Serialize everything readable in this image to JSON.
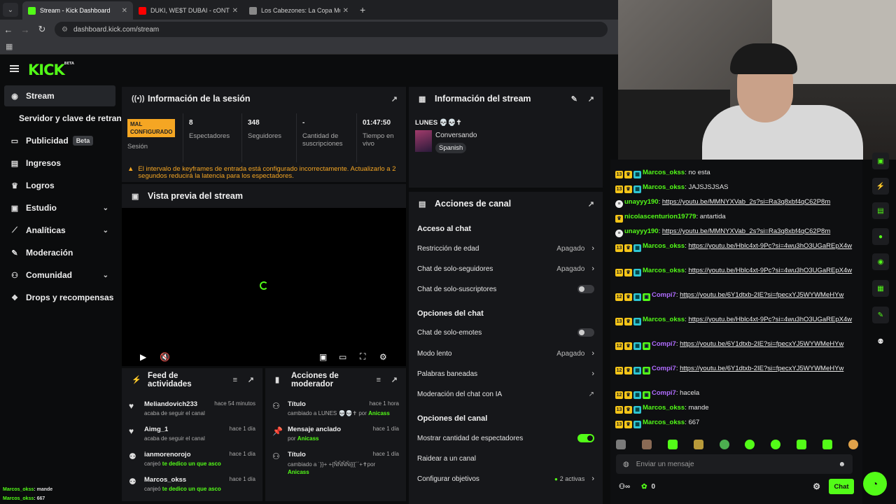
{
  "browser": {
    "tabs": [
      {
        "title": "Stream - Kick Dashboard",
        "color": "#53fc18"
      },
      {
        "title": "DUKI, WE$T DUBAI - cONTRA M",
        "color": "#ff0000"
      },
      {
        "title": "Los Cabezones: La Copa Mundi",
        "color": "#888888"
      }
    ],
    "url": "dashboard.kick.com/stream"
  },
  "header": {
    "logo": "KICK",
    "logo_tag": "BETA"
  },
  "sidebar": {
    "items": [
      {
        "label": "Stream",
        "icon": "broadcast-icon"
      },
      {
        "label": "Servidor y clave de retransmi"
      },
      {
        "label": "Publicidad",
        "badge": "Beta",
        "icon": "ads-icon"
      },
      {
        "label": "Ingresos",
        "icon": "revenue-icon"
      },
      {
        "label": "Logros",
        "icon": "trophy-icon"
      },
      {
        "label": "Estudio",
        "icon": "studio-icon"
      },
      {
        "label": "Analíticas",
        "icon": "chart-icon"
      },
      {
        "label": "Moderación",
        "icon": "wrench-icon"
      },
      {
        "label": "Comunidad",
        "icon": "community-icon"
      },
      {
        "label": "Drops y recompensas",
        "icon": "gift-icon"
      }
    ],
    "overlay_lines": [
      {
        "user": "Marcos_okss",
        "msg": ": mande"
      },
      {
        "user": "Marcos_okss",
        "msg": ": 667"
      }
    ]
  },
  "session": {
    "title": "Información de la sesión",
    "status_badge": "MAL CONFIGURADO",
    "status_label": "Sesión",
    "stats": [
      {
        "value": "8",
        "label": "Espectadores"
      },
      {
        "value": "348",
        "label": "Seguidores"
      },
      {
        "value": "-",
        "label": "Cantidad de suscripciones"
      },
      {
        "value": "01:47:50",
        "label": "Tiempo en vivo"
      }
    ],
    "warning": "El intervalo de keyframes de entrada está configurado incorrectamente. Actualizarlo a 2 segundos reducirá la latencia para los espectadores."
  },
  "preview": {
    "title": "Vista previa del stream"
  },
  "stream_info": {
    "title": "Información del stream",
    "stream_title": "LUNES 💀💀✝",
    "category": "Conversando",
    "language": "Spanish"
  },
  "channel_actions": {
    "title": "Acciones de canal",
    "sections": {
      "chat_access": "Acceso al chat",
      "chat_options": "Opciones del chat",
      "channel_options": "Opciones del canal"
    },
    "rows": {
      "age": {
        "label": "Restricción de edad",
        "value": "Apagado"
      },
      "followers": {
        "label": "Chat de solo-seguidores",
        "value": "Apagado"
      },
      "subs": {
        "label": "Chat de solo-suscriptores"
      },
      "emotes": {
        "label": "Chat de solo-emotes"
      },
      "slow": {
        "label": "Modo lento",
        "value": "Apagado"
      },
      "banned": {
        "label": "Palabras baneadas"
      },
      "ai_mod": {
        "label": "Moderación del chat con IA"
      },
      "viewer_count": {
        "label": "Mostrar cantidad de espectadores"
      },
      "raid": {
        "label": "Raidear a un canal"
      },
      "goals": {
        "label": "Configurar objetivos",
        "value": "2 activas"
      }
    }
  },
  "activity_feed": {
    "title": "Feed de actividades",
    "items": [
      {
        "user": "Meliandovich233",
        "time": "hace 54 minutos",
        "desc": "acaba de seguir el canal",
        "highlight": ""
      },
      {
        "user": "Aimg_1",
        "time": "hace 1 día",
        "desc": "acaba de seguir el canal",
        "highlight": ""
      },
      {
        "user": "ianmorenorojo",
        "time": "hace 1 día",
        "desc": "canjeó ",
        "highlight": "te dedico un que asco"
      },
      {
        "user": "Marcos_okss",
        "time": "hace 1 día",
        "desc": "canjeó ",
        "highlight": "te dedico un que asco"
      }
    ]
  },
  "mod_actions": {
    "title": "Acciones de moderador",
    "items": [
      {
        "title": "Título",
        "time": "hace 1 hora",
        "desc": "cambiado a LUNES 💀💀✝ por ",
        "by": "Anicass"
      },
      {
        "title": "Mensaje anclado",
        "time": "hace 1 día",
        "desc": "por ",
        "by": "Anicass"
      },
      {
        "title": "Título",
        "time": "hace 1 día",
        "desc": "cambiado a ˙}}+ +{ÑÑÑÑ{{{´´+✝por ",
        "by": "Anicass"
      }
    ]
  },
  "chat": {
    "messages": [
      {
        "badges": [
          "13",
          "crown",
          "sub"
        ],
        "user": "Marcos_okss",
        "color": "green",
        "text": "no esta"
      },
      {
        "badges": [
          "13",
          "crown",
          "sub"
        ],
        "user": "Marcos_okss",
        "color": "green",
        "text": "JAJSJSJSAS"
      },
      {
        "badges": [
          "spotify"
        ],
        "user": "unayyy190",
        "color": "green",
        "link": "https://youtu.be/MMNYXVab_2s?si=Ra3q8xbf4qC62P8m"
      },
      {
        "badges": [
          "crown"
        ],
        "user": "nicolascenturion19779",
        "color": "green",
        "text": "antartida"
      },
      {
        "badges": [
          "spotify"
        ],
        "user": "unayyy190",
        "color": "green",
        "link": "https://youtu.be/MMNYXVab_2s?si=Ra3q8xbf4qC62P8m"
      },
      {
        "badges": [
          "13",
          "crown",
          "sub"
        ],
        "user": "Marcos_okss",
        "color": "green",
        "link": "https://youtu.be/Hblc4xt-9Pc?si=4wu3hO3UGaREpX4w"
      },
      {
        "badges": [
          "13",
          "crown",
          "sub"
        ],
        "user": "Marcos_okss",
        "color": "green",
        "link": "https://youtu.be/Hblc4xt-9Pc?si=4wu3hO3UGaREpX4w"
      },
      {
        "badges": [
          "12",
          "crown",
          "sub",
          "gift"
        ],
        "user": "Compi7",
        "color": "purple",
        "link": "https://youtu.be/6Y1dtxb-2IE?si=fpecxYJ5WYWMeHYw"
      },
      {
        "badges": [
          "13",
          "crown",
          "sub"
        ],
        "user": "Marcos_okss",
        "color": "green",
        "link": "https://youtu.be/Hblc4xt-9Pc?si=4wu3hO3UGaREpX4w"
      },
      {
        "badges": [
          "12",
          "crown",
          "sub",
          "gift"
        ],
        "user": "Compi7",
        "color": "purple",
        "link": "https://youtu.be/6Y1dtxb-2IE?si=fpecxYJ5WYWMeHYw"
      },
      {
        "badges": [
          "12",
          "crown",
          "sub",
          "gift"
        ],
        "user": "Compi7",
        "color": "purple",
        "link": "https://youtu.be/6Y1dtxb-2IE?si=fpecxYJ5WYWMeHYw"
      },
      {
        "badges": [
          "12",
          "crown",
          "sub",
          "gift"
        ],
        "user": "Compi7",
        "color": "purple",
        "text": "hacela"
      },
      {
        "badges": [
          "13",
          "crown",
          "sub"
        ],
        "user": "Marcos_okss",
        "color": "green",
        "text": "mande"
      },
      {
        "badges": [
          "13",
          "crown",
          "sub"
        ],
        "user": "Marcos_okss",
        "color": "green",
        "text": "667"
      }
    ],
    "input_placeholder": "Enviar un mensaje",
    "footer_points": "0",
    "send_label": "Chat",
    "accent": "#53fc18"
  }
}
